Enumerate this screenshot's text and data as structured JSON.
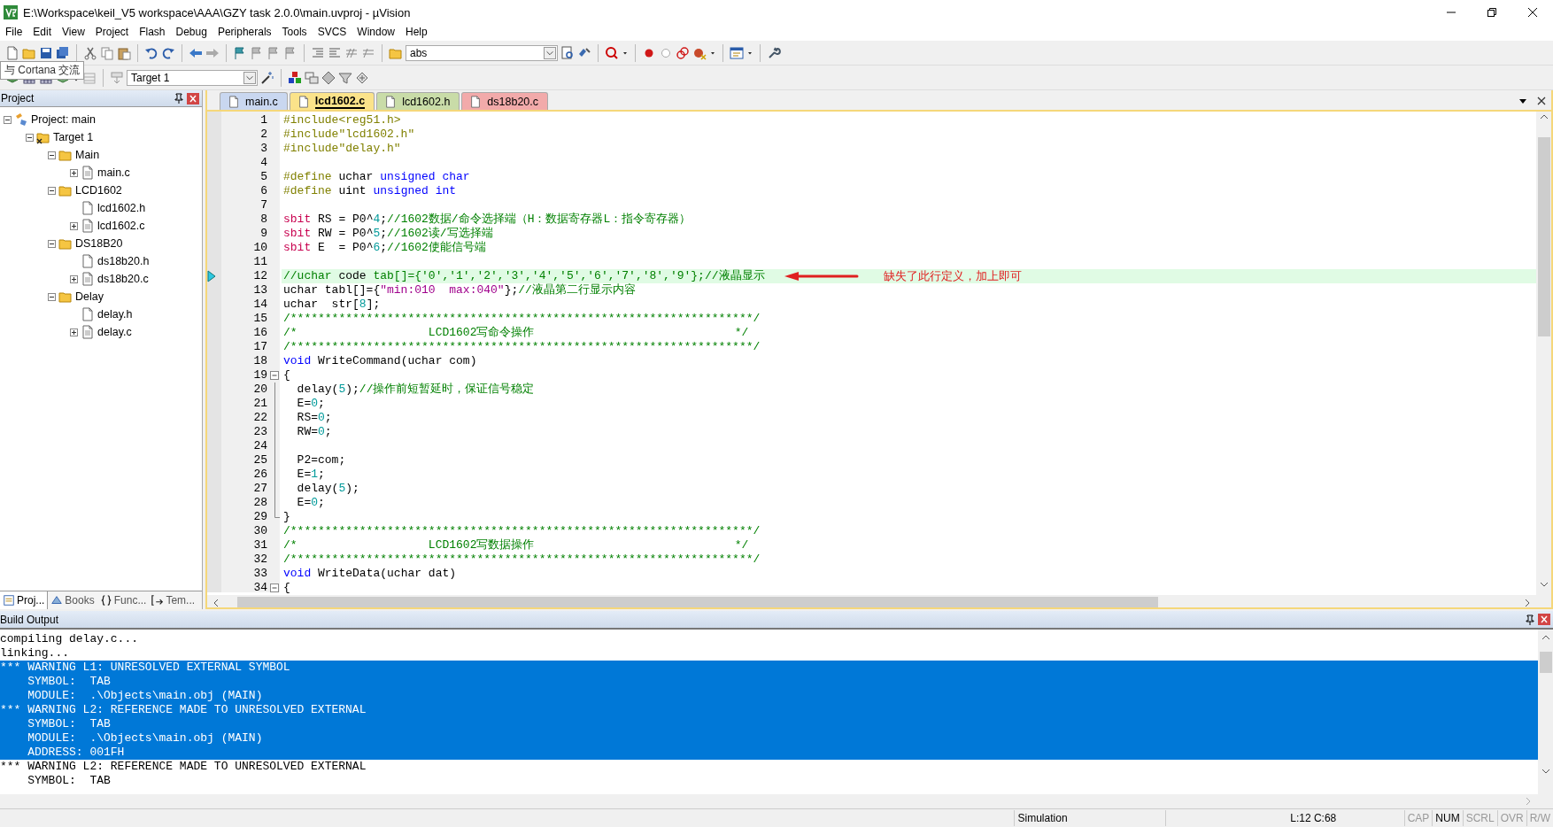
{
  "window": {
    "title": "E:\\Workspace\\keil_V5 workspace\\AAA\\GZY task 2.0.0\\main.uvproj - µVision"
  },
  "menu": [
    "File",
    "Edit",
    "View",
    "Project",
    "Flash",
    "Debug",
    "Peripherals",
    "Tools",
    "SVCS",
    "Window",
    "Help"
  ],
  "toolbar": {
    "find_combo": "abs",
    "target_combo": "Target 1",
    "tooltip": "与 Cortana 交流"
  },
  "project_panel": {
    "title": "Project",
    "tree": [
      {
        "label": "Project: main",
        "kind": "project",
        "expanded": true,
        "children": [
          {
            "label": "Target 1",
            "kind": "target",
            "expanded": true,
            "children": [
              {
                "label": "Main",
                "kind": "group",
                "expanded": true,
                "children": [
                  {
                    "label": "main.c",
                    "kind": "file",
                    "expanded": false
                  }
                ]
              },
              {
                "label": "LCD1602",
                "kind": "group",
                "expanded": true,
                "children": [
                  {
                    "label": "lcd1602.h",
                    "kind": "header"
                  },
                  {
                    "label": "lcd1602.c",
                    "kind": "file",
                    "expanded": false
                  }
                ]
              },
              {
                "label": "DS18B20",
                "kind": "group",
                "expanded": true,
                "children": [
                  {
                    "label": "ds18b20.h",
                    "kind": "header"
                  },
                  {
                    "label": "ds18b20.c",
                    "kind": "file",
                    "expanded": false
                  }
                ]
              },
              {
                "label": "Delay",
                "kind": "group",
                "expanded": true,
                "children": [
                  {
                    "label": "delay.h",
                    "kind": "header"
                  },
                  {
                    "label": "delay.c",
                    "kind": "file",
                    "expanded": false
                  }
                ]
              }
            ]
          }
        ]
      }
    ],
    "tabs": [
      {
        "label": "Proj...",
        "kind": "project",
        "selected": true
      },
      {
        "label": "Books",
        "kind": "books",
        "selected": false
      },
      {
        "label": "Func...",
        "kind": "functions",
        "selected": false
      },
      {
        "label": "Tem...",
        "kind": "templates",
        "selected": false
      }
    ]
  },
  "editor": {
    "tabs": [
      {
        "label": "main.c",
        "color": "#c9d7f0",
        "selected": false
      },
      {
        "label": "lcd1602.c",
        "color": "#fbe38a",
        "selected": true
      },
      {
        "label": "lcd1602.h",
        "color": "#c9dca8",
        "selected": false
      },
      {
        "label": "ds18b20.c",
        "color": "#f2aaaa",
        "selected": false
      }
    ],
    "lines": [
      {
        "n": "1",
        "current": false,
        "tokens": [
          {
            "kind": "pp",
            "text": "#include<reg51.h>"
          }
        ]
      },
      {
        "n": "2",
        "current": false,
        "tokens": [
          {
            "kind": "pp",
            "text": "#include\"lcd1602.h\""
          }
        ]
      },
      {
        "n": "3",
        "current": false,
        "tokens": [
          {
            "kind": "pp",
            "text": "#include\"delay.h\""
          }
        ]
      },
      {
        "n": "4",
        "current": false
      },
      {
        "n": "5",
        "current": false,
        "tokens": [
          {
            "kind": "pp",
            "text": "#define"
          },
          {
            "kind": "plain",
            "text": " uchar "
          },
          {
            "kind": "kw",
            "text": "unsigned char"
          }
        ]
      },
      {
        "n": "6",
        "current": false,
        "tokens": [
          {
            "kind": "pp",
            "text": "#define"
          },
          {
            "kind": "plain",
            "text": " uint "
          },
          {
            "kind": "kw",
            "text": "unsigned int"
          }
        ]
      },
      {
        "n": "7",
        "current": false
      },
      {
        "n": "8",
        "current": false,
        "tokens": [
          {
            "kind": "kw2",
            "text": "sbit"
          },
          {
            "kind": "plain",
            "text": " RS = P0^"
          },
          {
            "kind": "num",
            "text": "4"
          },
          {
            "kind": "plain",
            "text": ";"
          },
          {
            "kind": "cm",
            "text": "//1602数据/命令选择端（H：数据寄存器L：指令寄存器）"
          }
        ]
      },
      {
        "n": "9",
        "current": false,
        "tokens": [
          {
            "kind": "kw2",
            "text": "sbit"
          },
          {
            "kind": "plain",
            "text": " RW = P0^"
          },
          {
            "kind": "num",
            "text": "5"
          },
          {
            "kind": "plain",
            "text": ";"
          },
          {
            "kind": "cm",
            "text": "//1602读/写选择端"
          }
        ]
      },
      {
        "n": "10",
        "current": false,
        "tokens": [
          {
            "kind": "kw2",
            "text": "sbit"
          },
          {
            "kind": "plain",
            "text": " E  = P0^"
          },
          {
            "kind": "num",
            "text": "6"
          },
          {
            "kind": "plain",
            "text": ";"
          },
          {
            "kind": "cm",
            "text": "//1602使能信号端"
          }
        ]
      },
      {
        "n": "11",
        "current": false
      },
      {
        "n": "12",
        "current": true,
        "tokens": [
          {
            "kind": "cm",
            "text": "//uchar "
          },
          {
            "kind": "plain",
            "text": "code"
          },
          {
            "kind": "cm",
            "text": " tab[]={'0','1','2','3','4','5','6','7','8','9'};//液晶显示"
          }
        ],
        "note": "缺失了此行定义，加上即可"
      },
      {
        "n": "13",
        "current": false,
        "tokens": [
          {
            "kind": "plain",
            "text": "uchar tabl[]={"
          },
          {
            "kind": "str",
            "text": "\"min:010  max:040\""
          },
          {
            "kind": "plain",
            "text": "};"
          },
          {
            "kind": "cm",
            "text": "//液晶第二行显示内容"
          }
        ]
      },
      {
        "n": "14",
        "current": false,
        "tokens": [
          {
            "kind": "plain",
            "text": "uchar  str["
          },
          {
            "kind": "num",
            "text": "8"
          },
          {
            "kind": "plain",
            "text": "];"
          }
        ]
      },
      {
        "n": "15",
        "current": false,
        "tokens": [
          {
            "kind": "cm",
            "text": "/*******************************************************************/"
          }
        ]
      },
      {
        "n": "16",
        "current": false,
        "tokens": [
          {
            "kind": "cm",
            "text": "/*                   LCD1602写命令操作                             */"
          }
        ]
      },
      {
        "n": "17",
        "current": false,
        "tokens": [
          {
            "kind": "cm",
            "text": "/*******************************************************************/"
          }
        ]
      },
      {
        "n": "18",
        "current": false,
        "tokens": [
          {
            "kind": "kw",
            "text": "void"
          },
          {
            "kind": "plain",
            "text": " WriteCommand(uchar com)"
          }
        ]
      },
      {
        "n": "19",
        "current": false,
        "kind": "fold_start",
        "tokens": [
          {
            "kind": "plain",
            "text": "{"
          }
        ]
      },
      {
        "n": "20",
        "current": false,
        "kind": "fold_body",
        "tokens": [
          {
            "kind": "plain",
            "text": "  delay("
          },
          {
            "kind": "num",
            "text": "5"
          },
          {
            "kind": "plain",
            "text": ");"
          },
          {
            "kind": "cm",
            "text": "//操作前短暂延时，保证信号稳定"
          }
        ]
      },
      {
        "n": "21",
        "current": false,
        "kind": "fold_body",
        "tokens": [
          {
            "kind": "plain",
            "text": "  E="
          },
          {
            "kind": "num",
            "text": "0"
          },
          {
            "kind": "plain",
            "text": ";"
          }
        ]
      },
      {
        "n": "22",
        "current": false,
        "kind": "fold_body",
        "tokens": [
          {
            "kind": "plain",
            "text": "  RS="
          },
          {
            "kind": "num",
            "text": "0"
          },
          {
            "kind": "plain",
            "text": ";"
          }
        ]
      },
      {
        "n": "23",
        "current": false,
        "kind": "fold_body",
        "tokens": [
          {
            "kind": "plain",
            "text": "  RW="
          },
          {
            "kind": "num",
            "text": "0"
          },
          {
            "kind": "plain",
            "text": ";"
          }
        ]
      },
      {
        "n": "24",
        "current": false,
        "kind": "fold_body"
      },
      {
        "n": "25",
        "current": false,
        "kind": "fold_body",
        "tokens": [
          {
            "kind": "plain",
            "text": "  P2=com;"
          }
        ]
      },
      {
        "n": "26",
        "current": false,
        "kind": "fold_body",
        "tokens": [
          {
            "kind": "plain",
            "text": "  E="
          },
          {
            "kind": "num",
            "text": "1"
          },
          {
            "kind": "plain",
            "text": ";"
          }
        ]
      },
      {
        "n": "27",
        "current": false,
        "kind": "fold_body",
        "tokens": [
          {
            "kind": "plain",
            "text": "  delay("
          },
          {
            "kind": "num",
            "text": "5"
          },
          {
            "kind": "plain",
            "text": ");"
          }
        ]
      },
      {
        "n": "28",
        "current": false,
        "kind": "fold_body",
        "tokens": [
          {
            "kind": "plain",
            "text": "  E="
          },
          {
            "kind": "num",
            "text": "0"
          },
          {
            "kind": "plain",
            "text": ";"
          }
        ]
      },
      {
        "n": "29",
        "current": false,
        "kind": "fold_end",
        "tokens": [
          {
            "kind": "plain",
            "text": "}"
          }
        ]
      },
      {
        "n": "30",
        "current": false,
        "tokens": [
          {
            "kind": "cm",
            "text": "/*******************************************************************/"
          }
        ]
      },
      {
        "n": "31",
        "current": false,
        "tokens": [
          {
            "kind": "cm",
            "text": "/*                   LCD1602写数据操作                             */"
          }
        ]
      },
      {
        "n": "32",
        "current": false,
        "tokens": [
          {
            "kind": "cm",
            "text": "/*******************************************************************/"
          }
        ]
      },
      {
        "n": "33",
        "current": false,
        "tokens": [
          {
            "kind": "kw",
            "text": "void"
          },
          {
            "kind": "plain",
            "text": " WriteData(uchar dat)"
          }
        ]
      },
      {
        "n": "34",
        "current": false,
        "kind": "fold_start",
        "tokens": [
          {
            "kind": "plain",
            "text": "{"
          }
        ]
      }
    ]
  },
  "build_output": {
    "title": "Build Output",
    "lines": [
      {
        "text": "compiling delay.c...",
        "selected": false
      },
      {
        "text": "linking...",
        "selected": false
      },
      {
        "text": "*** WARNING L1: UNRESOLVED EXTERNAL SYMBOL",
        "selected": true
      },
      {
        "text": "    SYMBOL:  TAB",
        "selected": true
      },
      {
        "text": "    MODULE:  .\\Objects\\main.obj (MAIN)",
        "selected": true
      },
      {
        "text": "*** WARNING L2: REFERENCE MADE TO UNRESOLVED EXTERNAL",
        "selected": true
      },
      {
        "text": "    SYMBOL:  TAB",
        "selected": true
      },
      {
        "text": "    MODULE:  .\\Objects\\main.obj (MAIN)",
        "selected": true
      },
      {
        "text": "    ADDRESS: 001FH",
        "selected": true
      },
      {
        "text": "*** WARNING L2: REFERENCE MADE TO UNRESOLVED EXTERNAL",
        "selected": false
      },
      {
        "text": "    SYMBOL:  TAB",
        "selected": false
      }
    ]
  },
  "status_bar": {
    "mode": "Simulation",
    "position": "L:12 C:68",
    "indicators": [
      {
        "label": "CAP",
        "on": false
      },
      {
        "label": "NUM",
        "on": true
      },
      {
        "label": "SCRL",
        "on": false
      },
      {
        "label": "OVR",
        "on": false
      },
      {
        "label": "R/W",
        "on": false
      }
    ]
  }
}
